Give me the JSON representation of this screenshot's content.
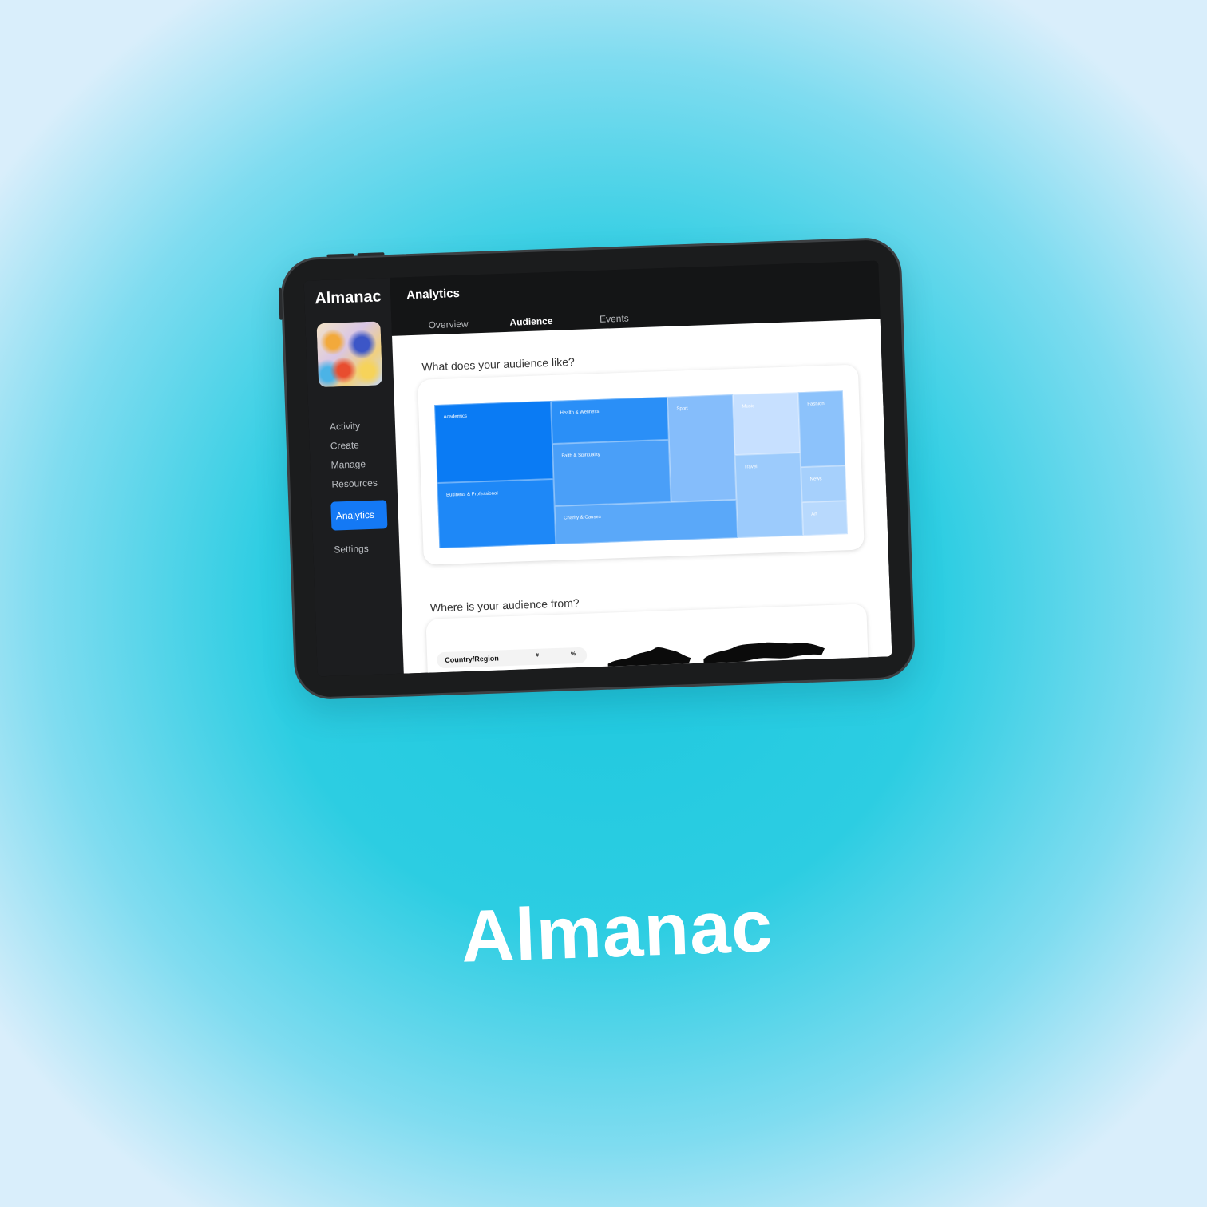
{
  "brand": {
    "title": "Almanac"
  },
  "app": {
    "logo": "Almanac",
    "avatar_icon": "marbled-paint-image"
  },
  "sidebar": {
    "items": [
      {
        "label": "Activity",
        "active": false
      },
      {
        "label": "Create",
        "active": false
      },
      {
        "label": "Manage",
        "active": false
      },
      {
        "label": "Resources",
        "active": false
      },
      {
        "label": "Analytics",
        "active": true
      },
      {
        "label": "Settings",
        "active": false
      }
    ]
  },
  "header": {
    "title": "Analytics",
    "tabs": [
      {
        "label": "Overview",
        "active": false
      },
      {
        "label": "Audience",
        "active": true
      },
      {
        "label": "Events",
        "active": false
      }
    ]
  },
  "interests": {
    "question": "What does your audience like?",
    "categories": [
      "Academics",
      "Business & Professional",
      "Health & Wellness",
      "Faith & Spirituality",
      "Charity & Causes",
      "Sport",
      "Music",
      "Travel",
      "Fashion",
      "News",
      "Art"
    ]
  },
  "location": {
    "question": "Where is your audience from?",
    "columns": [
      "Country/Region",
      "#",
      "%"
    ]
  },
  "colors": {
    "accent": "#1479f5",
    "tab_underline": "#3cd6a4",
    "treemap_dark": "#0a7bf4",
    "treemap_light": "#c7e0ff"
  }
}
